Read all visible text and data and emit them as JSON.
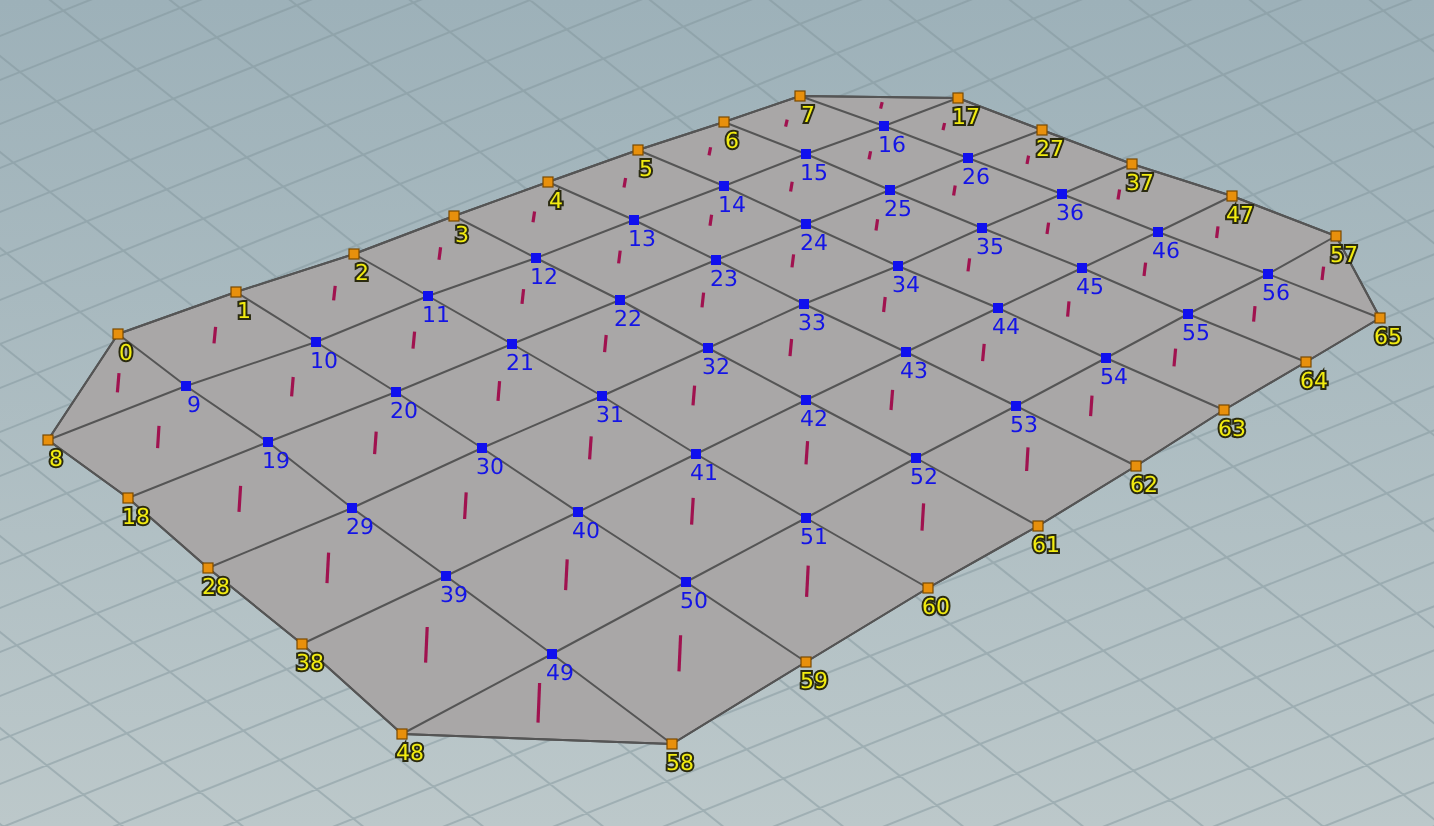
{
  "viewport": {
    "points": [
      {
        "label": "0",
        "kind": "boundary"
      },
      {
        "label": "1",
        "kind": "boundary"
      },
      {
        "label": "2",
        "kind": "boundary"
      },
      {
        "label": "3",
        "kind": "boundary"
      },
      {
        "label": "4",
        "kind": "boundary"
      },
      {
        "label": "5",
        "kind": "boundary"
      },
      {
        "label": "6",
        "kind": "boundary"
      },
      {
        "label": "7",
        "kind": "boundary"
      },
      {
        "label": "8",
        "kind": "boundary"
      },
      {
        "label": "9",
        "kind": "interior"
      },
      {
        "label": "10",
        "kind": "interior"
      },
      {
        "label": "11",
        "kind": "interior"
      },
      {
        "label": "12",
        "kind": "interior"
      },
      {
        "label": "13",
        "kind": "interior"
      },
      {
        "label": "14",
        "kind": "interior"
      },
      {
        "label": "15",
        "kind": "interior"
      },
      {
        "label": "16",
        "kind": "interior"
      },
      {
        "label": "17",
        "kind": "boundary"
      },
      {
        "label": "18",
        "kind": "boundary"
      },
      {
        "label": "19",
        "kind": "interior"
      },
      {
        "label": "20",
        "kind": "interior"
      },
      {
        "label": "21",
        "kind": "interior"
      },
      {
        "label": "22",
        "kind": "interior"
      },
      {
        "label": "23",
        "kind": "interior"
      },
      {
        "label": "24",
        "kind": "interior"
      },
      {
        "label": "25",
        "kind": "interior"
      },
      {
        "label": "26",
        "kind": "interior"
      },
      {
        "label": "27",
        "kind": "boundary"
      },
      {
        "label": "28",
        "kind": "boundary"
      },
      {
        "label": "29",
        "kind": "interior"
      },
      {
        "label": "30",
        "kind": "interior"
      },
      {
        "label": "31",
        "kind": "interior"
      },
      {
        "label": "32",
        "kind": "interior"
      },
      {
        "label": "33",
        "kind": "interior"
      },
      {
        "label": "34",
        "kind": "interior"
      },
      {
        "label": "35",
        "kind": "interior"
      },
      {
        "label": "36",
        "kind": "interior"
      },
      {
        "label": "37",
        "kind": "boundary"
      },
      {
        "label": "38",
        "kind": "boundary"
      },
      {
        "label": "39",
        "kind": "interior"
      },
      {
        "label": "40",
        "kind": "interior"
      },
      {
        "label": "41",
        "kind": "interior"
      },
      {
        "label": "42",
        "kind": "interior"
      },
      {
        "label": "43",
        "kind": "interior"
      },
      {
        "label": "44",
        "kind": "interior"
      },
      {
        "label": "45",
        "kind": "interior"
      },
      {
        "label": "46",
        "kind": "interior"
      },
      {
        "label": "47",
        "kind": "boundary"
      },
      {
        "label": "48",
        "kind": "boundary"
      },
      {
        "label": "49",
        "kind": "interior"
      },
      {
        "label": "50",
        "kind": "interior"
      },
      {
        "label": "51",
        "kind": "interior"
      },
      {
        "label": "52",
        "kind": "interior"
      },
      {
        "label": "53",
        "kind": "interior"
      },
      {
        "label": "54",
        "kind": "interior"
      },
      {
        "label": "55",
        "kind": "interior"
      },
      {
        "label": "56",
        "kind": "interior"
      },
      {
        "label": "57",
        "kind": "boundary"
      },
      {
        "label": "58",
        "kind": "boundary"
      },
      {
        "label": "59",
        "kind": "boundary"
      },
      {
        "label": "60",
        "kind": "boundary"
      },
      {
        "label": "61",
        "kind": "boundary"
      },
      {
        "label": "62",
        "kind": "boundary"
      },
      {
        "label": "63",
        "kind": "boundary"
      },
      {
        "label": "64",
        "kind": "boundary"
      },
      {
        "label": "65",
        "kind": "boundary"
      }
    ]
  }
}
